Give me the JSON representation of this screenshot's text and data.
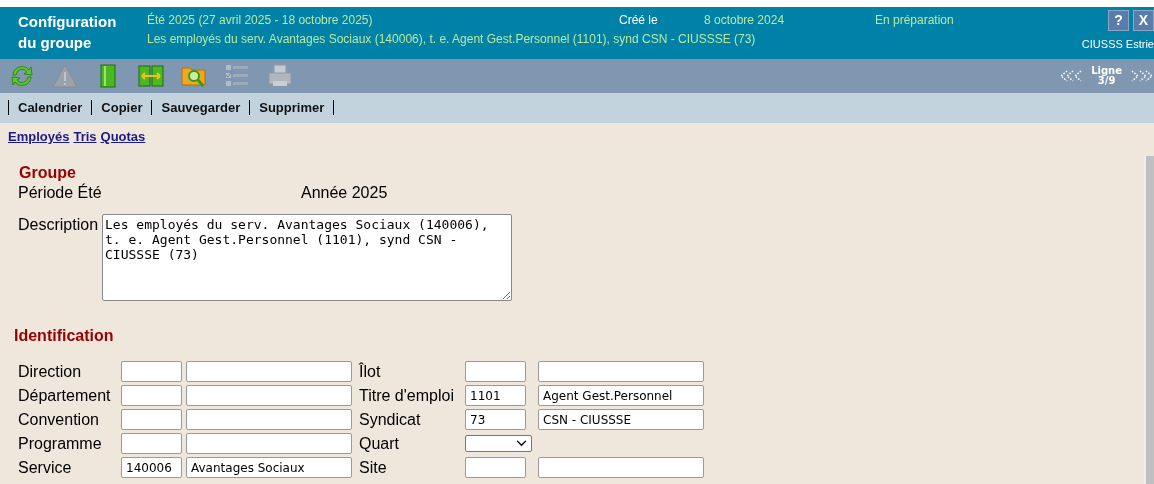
{
  "header": {
    "title": "Configuration du groupe",
    "period": "Été 2025 (27 avril 2025 - 18 octobre 2025)",
    "created_label": "Créé le",
    "created_date": "8 octobre 2024",
    "status": "En préparation",
    "description": "Les employés du serv. Avantages Sociaux (140006), t. e. Agent Gest.Personnel (1101), synd CSN - CIUSSSE (73)",
    "help_button": "?",
    "close_button": "X",
    "organization": "CIUSSS Estrie"
  },
  "toolbar": [
    {
      "kind": "refresh",
      "disabled": false
    },
    {
      "kind": "warning",
      "disabled": true
    },
    {
      "kind": "panel",
      "disabled": false
    },
    {
      "kind": "split",
      "disabled": false
    },
    {
      "kind": "search-folder",
      "disabled": false
    },
    {
      "kind": "checklist",
      "disabled": true
    },
    {
      "kind": "printer",
      "disabled": true
    }
  ],
  "navigation": {
    "label": "Ligne",
    "position": "3/9"
  },
  "menu": [
    "Calendrier",
    "Copier",
    "Sauvegarder",
    "Supprimer"
  ],
  "links": [
    "Employés",
    "Tris",
    "Quotas"
  ],
  "groupe": {
    "heading": "Groupe",
    "period_label": "Période Été",
    "year": "Année 2025",
    "description_label": "Description",
    "description": "Les employés du serv. Avantages Sociaux (140006), t. e. Agent Gest.Personnel (1101), synd CSN - CIUSSSE (73)"
  },
  "identification": {
    "heading": "Identification",
    "rows": [
      {
        "left": {
          "label": "Direction"
        },
        "right": {
          "label": "Îlot",
          "kind": "text"
        }
      },
      {
        "left": {
          "label": "Département"
        },
        "right": {
          "label": "Titre d'emploi",
          "kind": "text",
          "code": "1101",
          "name": "Agent Gest.Personnel"
        }
      },
      {
        "left": {
          "label": "Convention"
        },
        "right": {
          "label": "Syndicat",
          "kind": "text",
          "code": "73",
          "name": "CSN - CIUSSSE"
        }
      },
      {
        "left": {
          "label": "Programme"
        },
        "right": {
          "label": "Quart",
          "kind": "select"
        }
      },
      {
        "left": {
          "label": "Service",
          "code": "140006",
          "name": "Avantages Sociaux"
        },
        "right": {
          "label": "Site",
          "kind": "text"
        }
      }
    ]
  }
}
